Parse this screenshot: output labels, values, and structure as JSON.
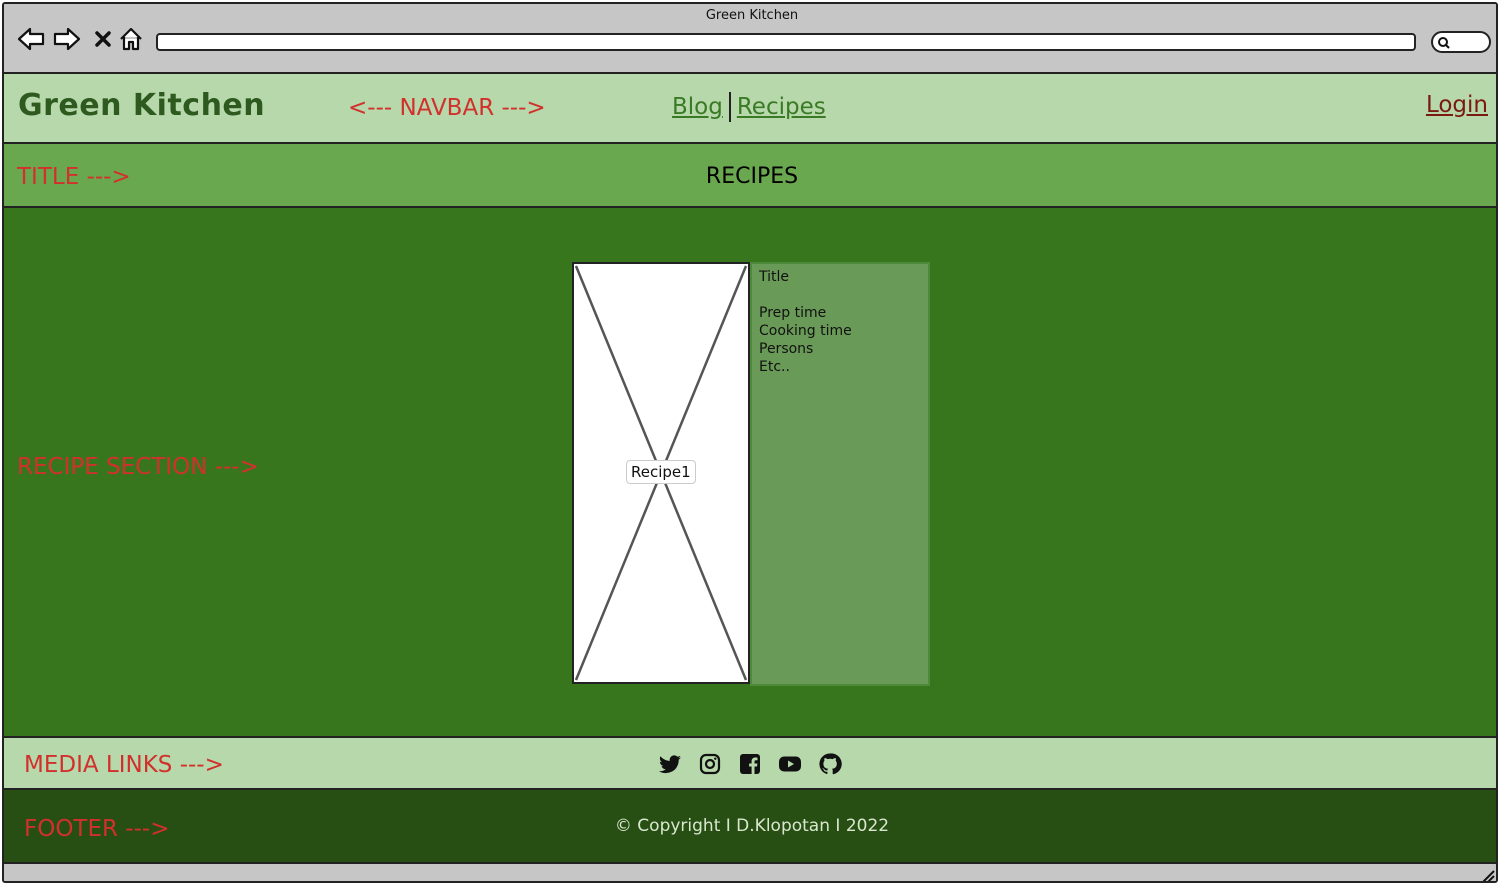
{
  "window": {
    "title": "Green Kitchen"
  },
  "toolbar": {
    "icons": [
      "back-arrow-icon",
      "forward-arrow-icon",
      "close-icon",
      "home-icon",
      "search-icon"
    ]
  },
  "navbar": {
    "brand": "Green Kitchen",
    "annotation": "<--- NAVBAR --->",
    "links": [
      "Blog",
      "Recipes"
    ],
    "login": "Login"
  },
  "title_section": {
    "annotation": "TITLE --->",
    "title": "RECIPES"
  },
  "recipe_section": {
    "annotation": "RECIPE SECTION --->",
    "card": {
      "image_label": "Recipe1",
      "info": [
        "Title",
        "",
        "Prep time",
        "Cooking time",
        "Persons",
        "Etc.."
      ]
    }
  },
  "media_section": {
    "annotation": "MEDIA LINKS --->",
    "icons": [
      "twitter-icon",
      "instagram-icon",
      "facebook-icon",
      "youtube-icon",
      "github-icon"
    ]
  },
  "footer": {
    "annotation": "FOOTER --->",
    "copyright": "© Copyright I D.Klopotan I 2022"
  },
  "colors": {
    "navbar": "#b6d8ab",
    "title": "#6aa84f",
    "recipe": "#38761d",
    "footer": "#274e13",
    "annotation": "#d2302c"
  }
}
